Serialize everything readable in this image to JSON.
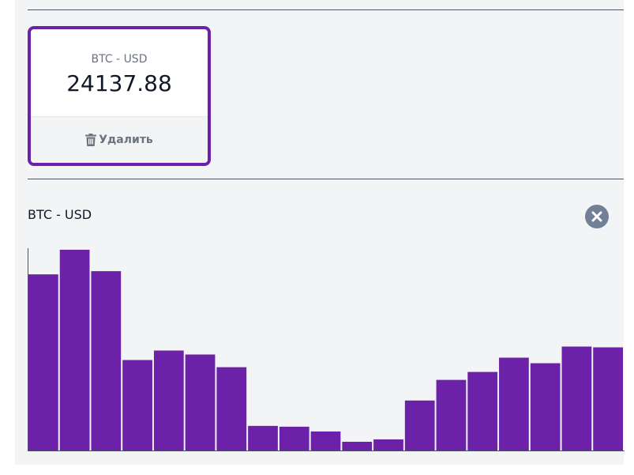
{
  "ticker": {
    "pair": "BTC - USD",
    "price": "24137.88",
    "delete_label": "Удалить"
  },
  "graph": {
    "title": "BTC - USD"
  },
  "chart_data": {
    "type": "bar",
    "values": [
      222,
      253,
      226,
      114,
      126,
      121,
      105,
      31,
      30,
      24,
      11,
      14,
      63,
      89,
      99,
      117,
      110,
      131,
      130
    ],
    "ylim": [
      0,
      255
    ],
    "color": "#6b21a8"
  },
  "colors": {
    "accent": "#6b21a8",
    "background": "#f3f4f6",
    "close": "#718096"
  },
  "icons": {
    "delete": "trash-icon",
    "close": "close-icon"
  }
}
